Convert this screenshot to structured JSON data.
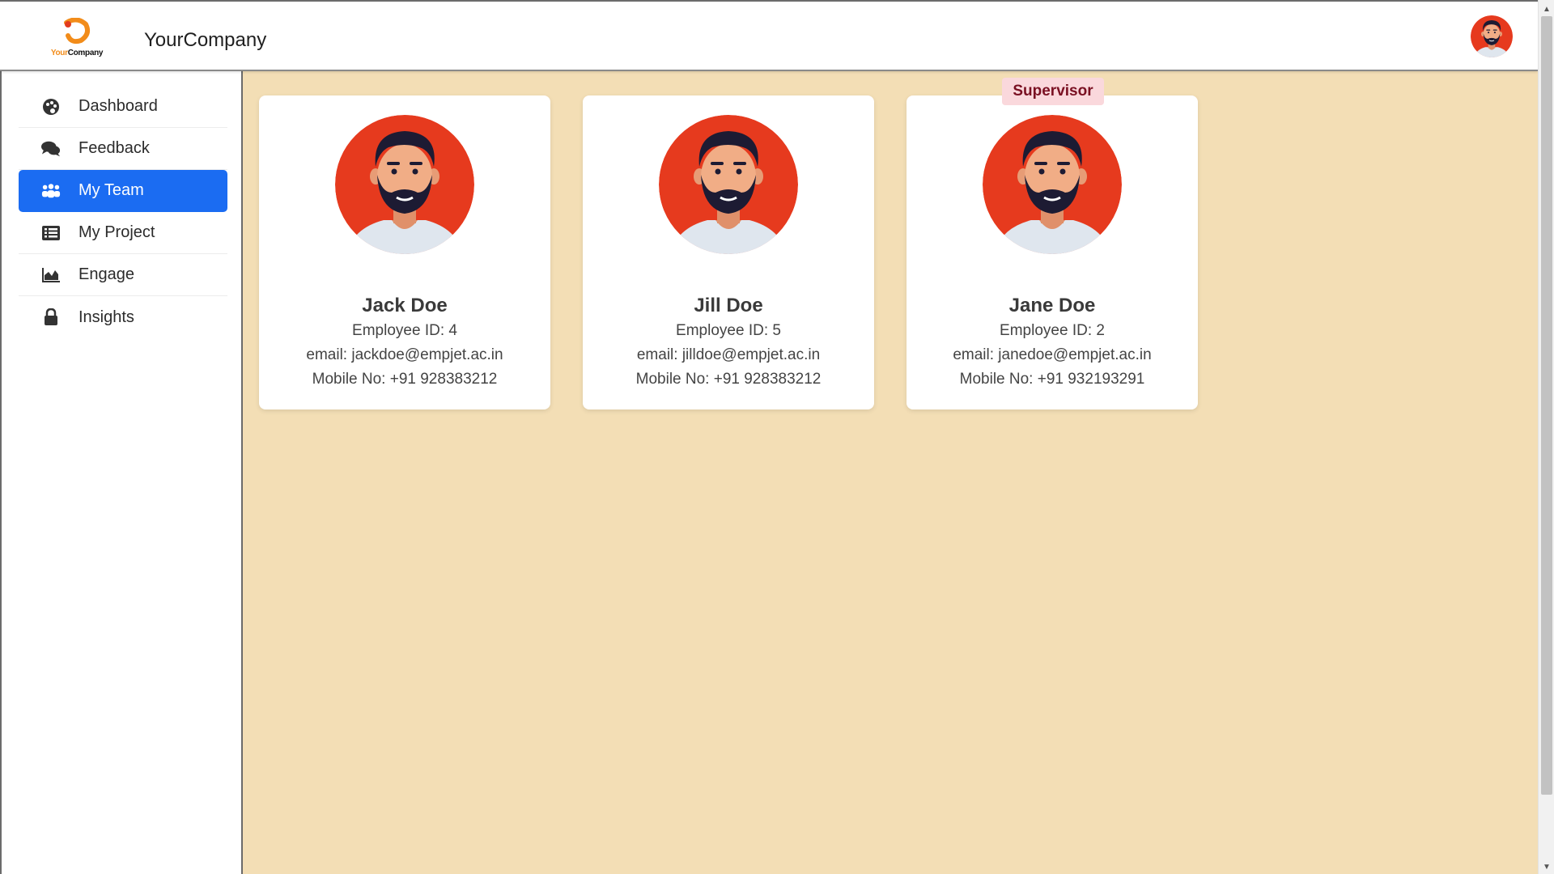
{
  "header": {
    "logo_text_a": "Your",
    "logo_text_b": "Company",
    "brand_name": "YourCompany",
    "user_avatar_icon": "user-avatar-icon"
  },
  "sidebar": {
    "items": [
      {
        "label": "Dashboard",
        "icon": "palette-icon",
        "active": false
      },
      {
        "label": "Feedback",
        "icon": "comments-icon",
        "active": false
      },
      {
        "label": "My Team",
        "icon": "users-icon",
        "active": true
      },
      {
        "label": "My Project",
        "icon": "list-icon",
        "active": false
      },
      {
        "label": "Engage",
        "icon": "area-chart-icon",
        "active": false
      },
      {
        "label": "Insights",
        "icon": "lock-icon",
        "active": false
      }
    ]
  },
  "team": {
    "members": [
      {
        "name": "Jack Doe",
        "employee_id": "Employee ID: 4",
        "email": "email: jackdoe@empjet.ac.in",
        "mobile": "Mobile No: +91 928383212"
      },
      {
        "name": "Jill Doe",
        "employee_id": "Employee ID: 5",
        "email": "email: jilldoe@empjet.ac.in",
        "mobile": "Mobile No: +91 928383212"
      },
      {
        "name": "Jane Doe",
        "employee_id": "Employee ID: 2",
        "email": "email: janedoe@empjet.ac.in",
        "mobile": "Mobile No: +91 932193291"
      }
    ],
    "supervisor_badge": "Supervisor"
  },
  "colors": {
    "accent": "#1b6cf2",
    "main_background": "#f3deb5",
    "avatar_background": "#e63a1e",
    "badge_background": "#fad8dc",
    "badge_text": "#7a1022"
  }
}
